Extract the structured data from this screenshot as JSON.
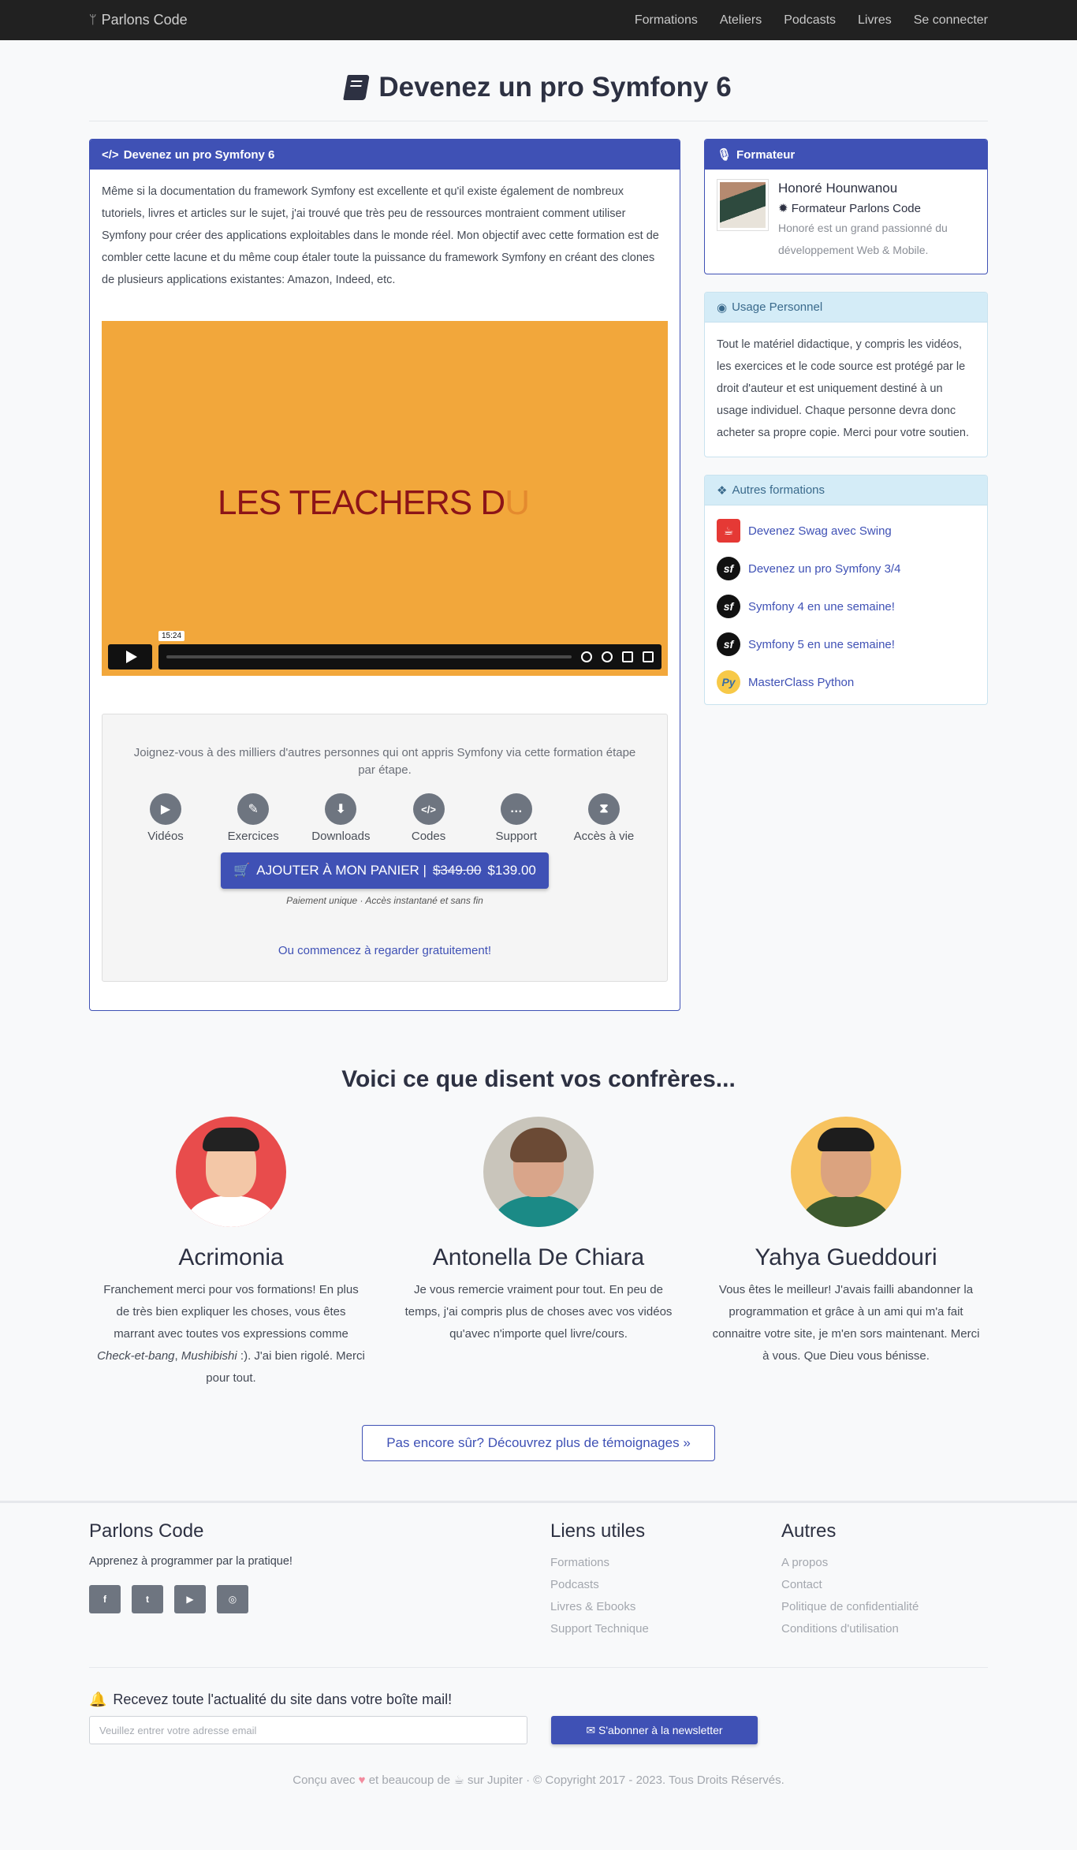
{
  "nav": {
    "brand": "Parlons Code",
    "links": [
      "Formations",
      "Ateliers",
      "Podcasts",
      "Livres",
      "Se connecter"
    ]
  },
  "page_title": "Devenez un pro Symfony 6",
  "course": {
    "card_title": "Devenez un pro Symfony 6",
    "intro": "Même si la documentation du framework Symfony est excellente et qu'il existe également de nombreux tutoriels, livres et articles sur le sujet, j'ai trouvé que très peu de ressources montraient comment utiliser Symfony pour créer des applications exploitables dans le monde réel. Mon objectif avec cette formation est de combler cette lacune et du même coup étaler toute la puissance du framework Symfony en créant des clones de plusieurs applications existantes: Amazon, Indeed, etc.",
    "video": {
      "title_main": "LES TEACHERS D",
      "title_fade": "U",
      "time": "15:24",
      "color": "#f2a73b"
    },
    "cta": {
      "text": "Joignez-vous à des milliers d'autres personnes qui ont appris Symfony via cette formation étape par étape.",
      "features": [
        {
          "icon": "video-camera-icon",
          "label": "Vidéos"
        },
        {
          "icon": "pencil-icon",
          "label": "Exercices"
        },
        {
          "icon": "download-icon",
          "label": "Downloads"
        },
        {
          "icon": "code-icon",
          "label": "Codes"
        },
        {
          "icon": "chat-icon",
          "label": "Support"
        },
        {
          "icon": "hourglass-icon",
          "label": "Accès à vie"
        }
      ],
      "buy_label": "AJOUTER À MON PANIER |",
      "old_price": "$349.00",
      "price": "$139.00",
      "pay_note": "Paiement unique · Accès instantané et sans fin",
      "free_prefix": "Ou",
      "free_link": "commencez à regarder gratuitement!"
    }
  },
  "trainer": {
    "card_title": "Formateur",
    "name": "Honoré Hounwanou",
    "role": "Formateur Parlons Code",
    "description": "Honoré est un grand passionné du développement Web & Mobile."
  },
  "usage": {
    "card_title": "Usage Personnel",
    "text": "Tout le matériel didactique, y compris les vidéos, les exercices et le code source est protégé par le droit d'auteur et est uniquement destiné à un usage individuel. Chaque personne devra donc acheter sa propre copie. Merci pour votre soutien."
  },
  "others": {
    "card_title": "Autres formations",
    "items": [
      {
        "label": "Devenez Swag avec Swing",
        "icon": "java-icon",
        "color": "#e53935"
      },
      {
        "label": "Devenez un pro Symfony 3/4",
        "icon": "symfony-icon",
        "color": "#111111"
      },
      {
        "label": "Symfony 4 en une semaine!",
        "icon": "symfony-icon",
        "color": "#111111"
      },
      {
        "label": "Symfony 5 en une semaine!",
        "icon": "symfony-icon",
        "color": "#111111"
      },
      {
        "label": "MasterClass Python",
        "icon": "python-icon",
        "color": "#f7c948"
      }
    ]
  },
  "testimonials": {
    "title": "Voici ce que disent vos confrères...",
    "items": [
      {
        "name": "Acrimonia",
        "text_before": "Franchement merci pour vos formations! En plus de très bien expliquer les choses, vous êtes marrant avec toutes vos expressions comme ",
        "em1": "Check-et-bang",
        "sep": ", ",
        "em2": "Mushibishi",
        "text_after": " :). J'ai bien rigolé. Merci pour tout.",
        "bg": "#e84c4c"
      },
      {
        "name": "Antonella De Chiara",
        "text_before": "Je vous remercie vraiment pour tout. En peu de temps, j'ai compris plus de choses avec vos vidéos qu'avec n'importe quel livre/cours.",
        "em1": "",
        "sep": "",
        "em2": "",
        "text_after": "",
        "bg": "#c9c5bb"
      },
      {
        "name": "Yahya Gueddouri",
        "text_before": "Vous êtes le meilleur! J'avais failli abandonner la programmation et grâce à un ami qui m'a fait connaitre votre site, je m'en sors maintenant. Merci à vous. Que Dieu vous bénisse.",
        "em1": "",
        "sep": "",
        "em2": "",
        "text_after": "",
        "bg": "#f7c35f"
      }
    ],
    "more_label": "Pas encore sûr? Découvrez plus de témoignages »"
  },
  "footer": {
    "brand": "Parlons Code",
    "tagline": "Apprenez à programmer par la pratique!",
    "social": [
      "facebook-icon",
      "twitter-icon",
      "youtube-icon",
      "github-icon"
    ],
    "useful_title": "Liens utiles",
    "useful": [
      "Formations",
      "Podcasts",
      "Livres & Ebooks",
      "Support Technique"
    ],
    "other_title": "Autres",
    "other": [
      "A propos",
      "Contact",
      "Politique de confidentialité",
      "Conditions d'utilisation"
    ],
    "newsletter": {
      "title": "Recevez toute l'actualité du site dans votre boîte mail!",
      "placeholder": "Veuillez entrer votre adresse email",
      "button": "S'abonner à la newsletter"
    },
    "copyright_a": "Conçu avec",
    "copyright_b": "et beaucoup de",
    "copyright_c": "sur Jupiter · © Copyright 2017 - 2023. Tous Droits Réservés."
  }
}
